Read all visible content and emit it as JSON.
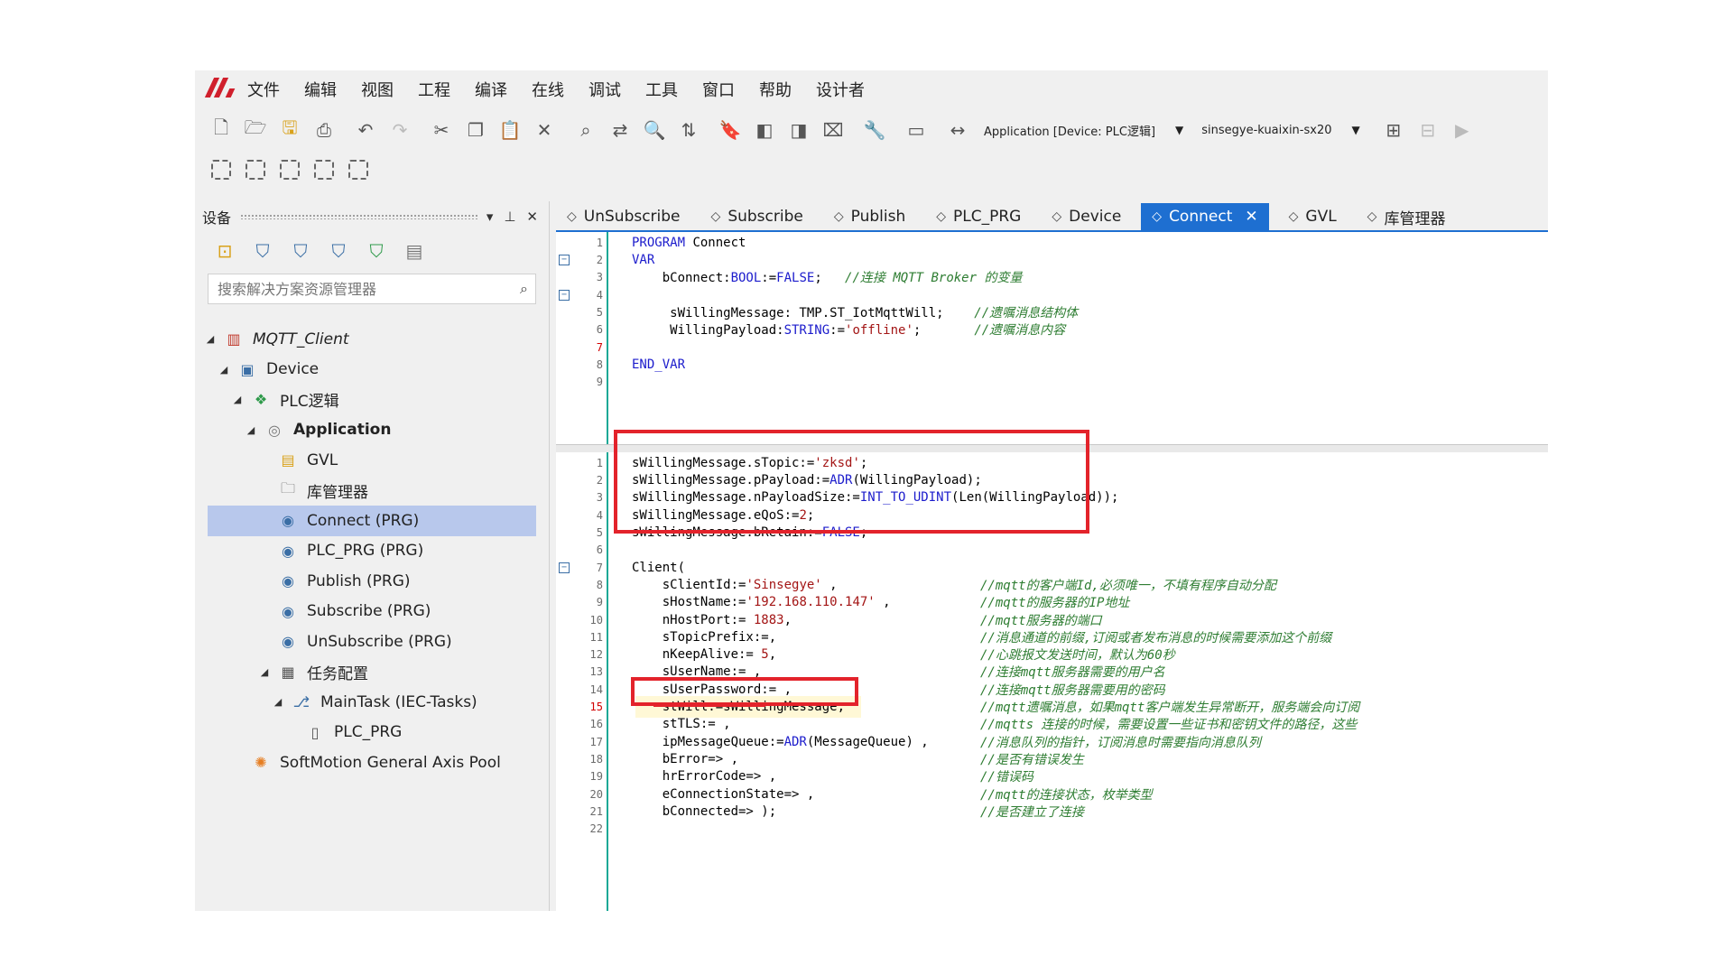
{
  "menubar": {
    "items": [
      "文件",
      "编辑",
      "视图",
      "工程",
      "编译",
      "在线",
      "调试",
      "工具",
      "窗口",
      "帮助",
      "设计者"
    ]
  },
  "toolbar": {
    "application_combo": "Application [Device: PLC逻辑]",
    "device_combo": "sinsegye-kuaixin-sx20"
  },
  "left_panel": {
    "title": "设备",
    "search_placeholder": "搜索解决方案资源管理器",
    "tree": [
      {
        "label": "MQTT_Client",
        "level": 0,
        "expanded": true,
        "style": "italic",
        "icon": "project-icon"
      },
      {
        "label": "Device",
        "level": 1,
        "expanded": true,
        "icon": "device-icon"
      },
      {
        "label": "PLC逻辑",
        "level": 2,
        "expanded": true,
        "icon": "plc-logic-icon"
      },
      {
        "label": "Application",
        "level": 3,
        "expanded": true,
        "style": "bold",
        "icon": "application-icon"
      },
      {
        "label": "GVL",
        "level": 4,
        "icon": "gvl-icon"
      },
      {
        "label": "库管理器",
        "level": 4,
        "icon": "library-folder-icon"
      },
      {
        "label": "Connect (PRG)",
        "level": 4,
        "selected": true,
        "icon": "program-icon"
      },
      {
        "label": "PLC_PRG (PRG)",
        "level": 4,
        "icon": "program-icon"
      },
      {
        "label": "Publish (PRG)",
        "level": 4,
        "icon": "program-icon"
      },
      {
        "label": "Subscribe (PRG)",
        "level": 4,
        "icon": "program-icon"
      },
      {
        "label": "UnSubscribe (PRG)",
        "level": 4,
        "icon": "program-icon"
      },
      {
        "label": "任务配置",
        "level": 4,
        "expanded": true,
        "icon": "task-config-icon"
      },
      {
        "label": "MainTask (IEC-Tasks)",
        "level": 5,
        "expanded": true,
        "icon": "task-icon"
      },
      {
        "label": "PLC_PRG",
        "level": 6,
        "icon": "program-call-icon"
      },
      {
        "label": "SoftMotion General Axis Pool",
        "level": 2,
        "icon": "axis-pool-icon"
      }
    ]
  },
  "tabs": [
    {
      "label": "UnSubscribe",
      "active": false
    },
    {
      "label": "Subscribe",
      "active": false
    },
    {
      "label": "Publish",
      "active": false
    },
    {
      "label": "PLC_PRG",
      "active": false
    },
    {
      "label": "Device",
      "active": false
    },
    {
      "label": "Connect",
      "active": true
    },
    {
      "label": "GVL",
      "active": false
    },
    {
      "label": "库管理器",
      "active": false
    }
  ],
  "declaration": {
    "lines": [
      {
        "n": "1",
        "code": [
          [
            "kw",
            "PROGRAM"
          ],
          [
            "t",
            " Connect"
          ]
        ]
      },
      {
        "n": "2",
        "fold": true,
        "code": [
          [
            "kw",
            "VAR"
          ]
        ]
      },
      {
        "n": "3",
        "code": [
          [
            "t",
            "    bConnect:"
          ],
          [
            "kw",
            "BOOL"
          ],
          [
            "t",
            ":="
          ],
          [
            "kw",
            "FALSE"
          ],
          [
            "t",
            ";   "
          ],
          [
            "cm",
            "//连接 MQTT Broker 的变量"
          ]
        ]
      },
      {
        "n": "4",
        "fold": true,
        "code": []
      },
      {
        "n": "5",
        "code": [
          [
            "t",
            "     sWillingMessage: TMP.ST_IotMqttWill;    "
          ],
          [
            "cm",
            "//遗嘱消息结构体"
          ]
        ]
      },
      {
        "n": "6",
        "code": [
          [
            "t",
            "     WillingPayload:"
          ],
          [
            "kw",
            "STRING"
          ],
          [
            "t",
            ":="
          ],
          [
            "str",
            "'offline'"
          ],
          [
            "t",
            ";       "
          ],
          [
            "cm",
            "//遗嘱消息内容"
          ]
        ]
      },
      {
        "n": "7",
        "red": true,
        "code": []
      },
      {
        "n": "8",
        "code": [
          [
            "kw",
            "END_VAR"
          ]
        ]
      },
      {
        "n": "9",
        "code": []
      }
    ]
  },
  "implementation": {
    "lines": [
      {
        "n": "1",
        "code": [
          [
            "t",
            "sWillingMessage.sTopic:="
          ],
          [
            "str",
            "'zksd'"
          ],
          [
            "t",
            ";"
          ]
        ]
      },
      {
        "n": "2",
        "code": [
          [
            "t",
            "sWillingMessage.pPayload:="
          ],
          [
            "kw",
            "ADR"
          ],
          [
            "t",
            "(WillingPayload);"
          ]
        ]
      },
      {
        "n": "3",
        "code": [
          [
            "t",
            "sWillingMessage.nPayloadSize:="
          ],
          [
            "kw",
            "INT_TO_UDINT"
          ],
          [
            "t",
            "(Len(WillingPayload));"
          ]
        ]
      },
      {
        "n": "4",
        "code": [
          [
            "t",
            "sWillingMessage.eQoS:="
          ],
          [
            "num",
            "2"
          ],
          [
            "t",
            ";"
          ]
        ]
      },
      {
        "n": "5",
        "code": [
          [
            "t",
            "sWillingMessage.bRetain:="
          ],
          [
            "kw",
            "FALSE"
          ],
          [
            "t",
            ";"
          ]
        ]
      },
      {
        "n": "6",
        "code": []
      },
      {
        "n": "7",
        "fold": true,
        "code": [
          [
            "t",
            "Client("
          ]
        ]
      },
      {
        "n": "8",
        "code": [
          [
            "t",
            "    sClientId:="
          ],
          [
            "str",
            "'Sinsegye'"
          ],
          [
            "t",
            " ,"
          ]
        ],
        "comment": "//mqtt的客户端Id,必须唯一，不填有程序自动分配"
      },
      {
        "n": "9",
        "code": [
          [
            "t",
            "    sHostName:="
          ],
          [
            "str",
            "'192.168.110.147'"
          ],
          [
            "t",
            " ,"
          ]
        ],
        "comment": "//mqtt的服务器的IP地址"
      },
      {
        "n": "10",
        "code": [
          [
            "t",
            "    nHostPort:= "
          ],
          [
            "num",
            "1883"
          ],
          [
            "t",
            ","
          ]
        ],
        "comment": "//mqtt服务器的端口"
      },
      {
        "n": "11",
        "code": [
          [
            "t",
            "    sTopicPrefix:=,"
          ]
        ],
        "comment": "//消息通道的前缀,订阅或者发布消息的时候需要添加这个前缀"
      },
      {
        "n": "12",
        "code": [
          [
            "t",
            "    nKeepAlive:= "
          ],
          [
            "num",
            "5"
          ],
          [
            "t",
            ","
          ]
        ],
        "comment": "//心跳报文发送时间，默认为60秒"
      },
      {
        "n": "13",
        "code": [
          [
            "t",
            "    sUserName:= ,"
          ]
        ],
        "comment": "//连接mqtt服务器需要的用户名"
      },
      {
        "n": "14",
        "code": [
          [
            "t",
            "    sUserPassword:= ,"
          ]
        ],
        "comment": "//连接mqtt服务器需要用的密码"
      },
      {
        "n": "15",
        "red": true,
        "hl": true,
        "code": [
          [
            "t",
            "    stWill:=sWillingMessage,"
          ]
        ],
        "comment": "//mqtt遗嘱消息，如果mqtt客户端发生异常断开，服务端会向订阅"
      },
      {
        "n": "16",
        "code": [
          [
            "t",
            "    stTLS:= ,"
          ]
        ],
        "comment": "//mqtts 连接的时候，需要设置一些证书和密钥文件的路径，这些"
      },
      {
        "n": "17",
        "code": [
          [
            "t",
            "    ipMessageQueue:="
          ],
          [
            "kw",
            "ADR"
          ],
          [
            "t",
            "(MessageQueue) ,"
          ]
        ],
        "comment": "//消息队列的指针，订阅消息时需要指向消息队列"
      },
      {
        "n": "18",
        "code": [
          [
            "t",
            "    bError=> ,"
          ]
        ],
        "comment": "//是否有错误发生"
      },
      {
        "n": "19",
        "code": [
          [
            "t",
            "    hrErrorCode=> ,"
          ]
        ],
        "comment": "//错误码"
      },
      {
        "n": "20",
        "code": [
          [
            "t",
            "    eConnectionState=> ,"
          ]
        ],
        "comment": "//mqtt的连接状态，枚举类型"
      },
      {
        "n": "21",
        "code": [
          [
            "t",
            "    bConnected=> );"
          ]
        ],
        "comment": "//是否建立了连接"
      },
      {
        "n": "22",
        "code": []
      }
    ]
  }
}
